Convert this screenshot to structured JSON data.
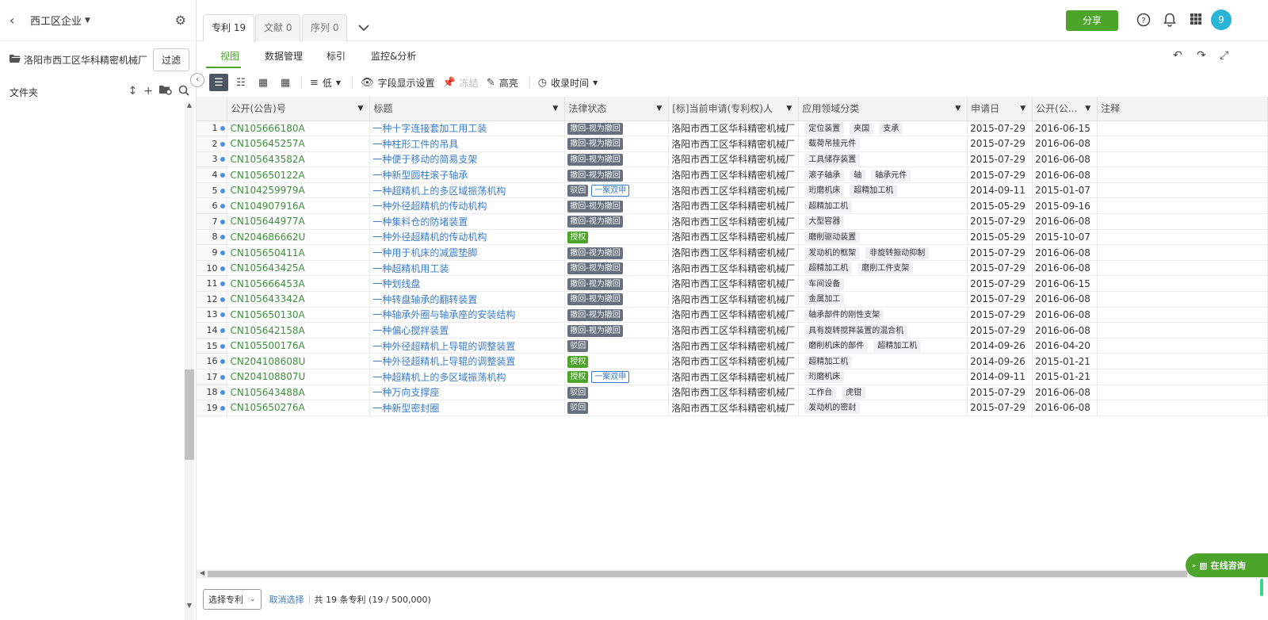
{
  "sidebar": {
    "back_icon": "chevron-left-icon",
    "title": "西工区企业",
    "settings_icon": "gear-icon",
    "project_name": "洛阳市西工区华科精密机械厂",
    "filter_label": "过滤",
    "folder_label": "文件夹"
  },
  "tabs": [
    {
      "label": "专利 19",
      "active": true
    },
    {
      "label": "文献 0",
      "active": false
    },
    {
      "label": "序列 0",
      "active": false
    }
  ],
  "header": {
    "share_label": "分享",
    "avatar_text": "9"
  },
  "subtabs": [
    {
      "label": "视图",
      "active": true
    },
    {
      "label": "数据管理",
      "active": false
    },
    {
      "label": "标引",
      "active": false
    },
    {
      "label": "监控&分析",
      "active": false
    }
  ],
  "toolbar": {
    "density_label": "低",
    "fields_label": "字段显示设置",
    "freeze_label": "冻结",
    "highlight_label": "高亮",
    "sort_label": "收录时间"
  },
  "table": {
    "columns": [
      "公开(公告)号",
      "标题",
      "法律状态",
      "[标]当前申请(专利权)人",
      "应用领域分类",
      "申请日",
      "公开(公...",
      "注释"
    ],
    "rows": [
      {
        "no": "1",
        "pn": "CN105666180A",
        "title": "一种十字连接套加工用工装",
        "status": [
          "撤回-视为撤回"
        ],
        "applicant": "洛阳市西工区华科精密机械厂",
        "fields": [
          "定位装置",
          "夹国",
          "支承"
        ],
        "app_date": "2015-07-29",
        "pub_date": "2016-06-15"
      },
      {
        "no": "2",
        "pn": "CN105645257A",
        "title": "一种柱形工件的吊具",
        "status": [
          "撤回-视为撤回"
        ],
        "applicant": "洛阳市西工区华科精密机械厂",
        "fields": [
          "载荷吊挂元件"
        ],
        "app_date": "2015-07-29",
        "pub_date": "2016-06-08"
      },
      {
        "no": "3",
        "pn": "CN105643582A",
        "title": "一种便于移动的简易支架",
        "status": [
          "撤回-视为撤回"
        ],
        "applicant": "洛阳市西工区华科精密机械厂",
        "fields": [
          "工具储存装置"
        ],
        "app_date": "2015-07-29",
        "pub_date": "2016-06-08"
      },
      {
        "no": "4",
        "pn": "CN105650122A",
        "title": "一种新型圆柱滚子轴承",
        "status": [
          "撤回-视为撤回"
        ],
        "applicant": "洛阳市西工区华科精密机械厂",
        "fields": [
          "滚子轴承",
          "轴",
          "轴承元件"
        ],
        "app_date": "2015-07-29",
        "pub_date": "2016-06-08"
      },
      {
        "no": "5",
        "pn": "CN104259979A",
        "title": "一种超精机上的多区域振荡机构",
        "status": [
          "驳回",
          "一案双申"
        ],
        "applicant": "洛阳市西工区华科精密机械厂",
        "fields": [
          "珩磨机床",
          "超精加工机"
        ],
        "app_date": "2014-09-11",
        "pub_date": "2015-01-07"
      },
      {
        "no": "6",
        "pn": "CN104907916A",
        "title": "一种外径超精机的传动机构",
        "status": [
          "撤回-视为撤回"
        ],
        "applicant": "洛阳市西工区华科精密机械厂",
        "fields": [
          "超精加工机"
        ],
        "app_date": "2015-05-29",
        "pub_date": "2015-09-16"
      },
      {
        "no": "7",
        "pn": "CN105644977A",
        "title": "一种集料仓的防堵装置",
        "status": [
          "撤回-视为撤回"
        ],
        "applicant": "洛阳市西工区华科精密机械厂",
        "fields": [
          "大型容器"
        ],
        "app_date": "2015-07-29",
        "pub_date": "2016-06-08"
      },
      {
        "no": "8",
        "pn": "CN204686662U",
        "title": "一种外径超精机的传动机构",
        "status": [
          "授权"
        ],
        "applicant": "洛阳市西工区华科精密机械厂",
        "fields": [
          "磨削驱动装置"
        ],
        "app_date": "2015-05-29",
        "pub_date": "2015-10-07"
      },
      {
        "no": "9",
        "pn": "CN105650411A",
        "title": "一种用于机床的减震垫脚",
        "status": [
          "撤回-视为撤回"
        ],
        "applicant": "洛阳市西工区华科精密机械厂",
        "fields": [
          "发动机的框架",
          "非旋转振动抑制"
        ],
        "app_date": "2015-07-29",
        "pub_date": "2016-06-08"
      },
      {
        "no": "10",
        "pn": "CN105643425A",
        "title": "一种超精机用工装",
        "status": [
          "撤回-视为撤回"
        ],
        "applicant": "洛阳市西工区华科精密机械厂",
        "fields": [
          "超精加工机",
          "磨削工件支架"
        ],
        "app_date": "2015-07-29",
        "pub_date": "2016-06-08"
      },
      {
        "no": "11",
        "pn": "CN105666453A",
        "title": "一种划线盘",
        "status": [
          "撤回-视为撤回"
        ],
        "applicant": "洛阳市西工区华科精密机械厂",
        "fields": [
          "车间设备"
        ],
        "app_date": "2015-07-29",
        "pub_date": "2016-06-15"
      },
      {
        "no": "12",
        "pn": "CN105643342A",
        "title": "一种转盘轴承的翻转装置",
        "status": [
          "撤回-视为撤回"
        ],
        "applicant": "洛阳市西工区华科精密机械厂",
        "fields": [
          "金属加工"
        ],
        "app_date": "2015-07-29",
        "pub_date": "2016-06-08"
      },
      {
        "no": "13",
        "pn": "CN105650130A",
        "title": "一种轴承外圈与轴承座的安装结构",
        "status": [
          "撤回-视为撤回"
        ],
        "applicant": "洛阳市西工区华科精密机械厂",
        "fields": [
          "轴承部件的刚性支架"
        ],
        "app_date": "2015-07-29",
        "pub_date": "2016-06-08"
      },
      {
        "no": "14",
        "pn": "CN105642158A",
        "title": "一种偏心搅拌装置",
        "status": [
          "撤回-视为撤回"
        ],
        "applicant": "洛阳市西工区华科精密机械厂",
        "fields": [
          "具有旋转搅拌装置的混合机"
        ],
        "app_date": "2015-07-29",
        "pub_date": "2016-06-08"
      },
      {
        "no": "15",
        "pn": "CN105500176A",
        "title": "一种外径超精机上导辊的调整装置",
        "status": [
          "驳回"
        ],
        "applicant": "洛阳市西工区华科精密机械厂",
        "fields": [
          "磨削机床的部件",
          "超精加工机"
        ],
        "app_date": "2014-09-26",
        "pub_date": "2016-04-20"
      },
      {
        "no": "16",
        "pn": "CN204108608U",
        "title": "一种外径超精机上导辊的调整装置",
        "status": [
          "授权"
        ],
        "applicant": "洛阳市西工区华科精密机械厂",
        "fields": [
          "超精加工机"
        ],
        "app_date": "2014-09-26",
        "pub_date": "2015-01-21"
      },
      {
        "no": "17",
        "pn": "CN204108807U",
        "title": "一种超精机上的多区域振荡机构",
        "status": [
          "授权",
          "一案双申"
        ],
        "applicant": "洛阳市西工区华科精密机械厂",
        "fields": [
          "珩磨机床"
        ],
        "app_date": "2014-09-11",
        "pub_date": "2015-01-21"
      },
      {
        "no": "18",
        "pn": "CN105643488A",
        "title": "一种万向支撑座",
        "status": [
          "驳回"
        ],
        "applicant": "洛阳市西工区华科精密机械厂",
        "fields": [
          "工作台",
          "虎钳"
        ],
        "app_date": "2015-07-29",
        "pub_date": "2016-06-08"
      },
      {
        "no": "19",
        "pn": "CN105650276A",
        "title": "一种新型密封圈",
        "status": [
          "驳回"
        ],
        "applicant": "洛阳市西工区华科精密机械厂",
        "fields": [
          "发动机的密封"
        ],
        "app_date": "2015-07-29",
        "pub_date": "2016-06-08"
      }
    ]
  },
  "footer": {
    "select_label": "选择专利",
    "cancel_label": "取消选择",
    "count_text": "共 19 条专利 (19 / 500,000)"
  },
  "chat": {
    "label": "在线咨询"
  },
  "colors": {
    "accent": "#4ca42a",
    "link": "#3a7bc8",
    "status_grey": "#66707e"
  }
}
